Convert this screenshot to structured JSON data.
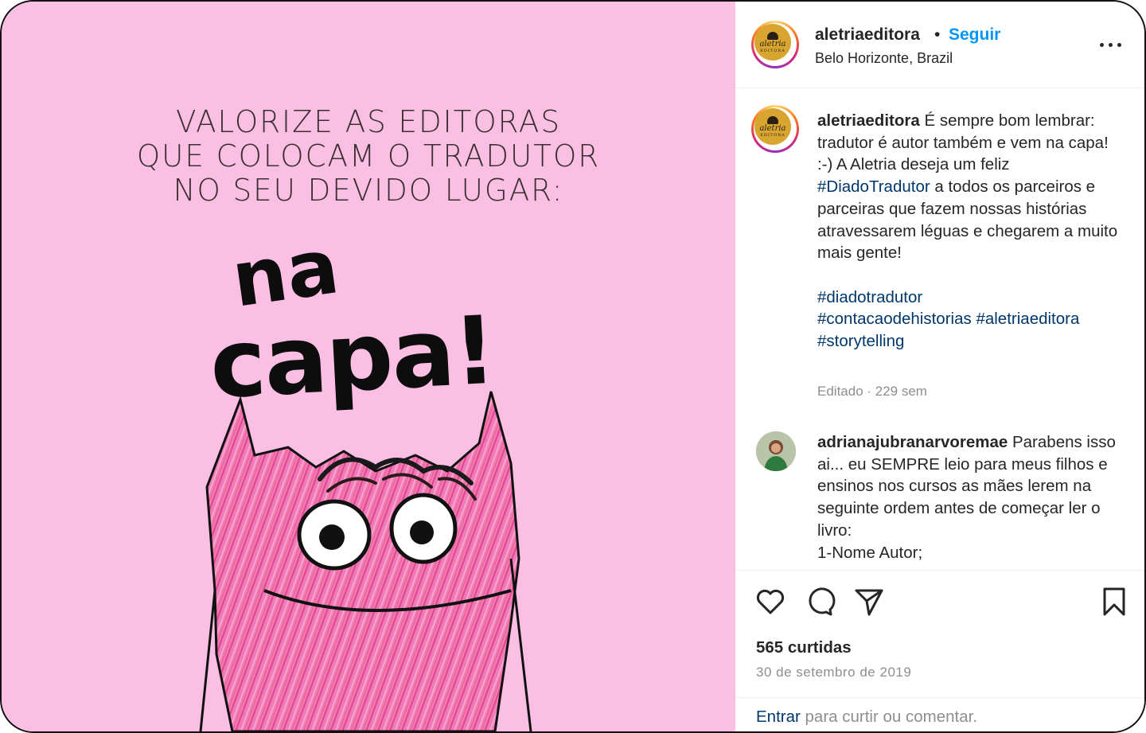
{
  "media": {
    "headline": [
      "VALORIZE AS EDITORAS",
      "QUE COLOCAM O TRADUTOR",
      "NO SEU DEVIDO LUGAR:"
    ],
    "big_text_line1": "na",
    "big_text_line2": "capa!",
    "background_color": "#fcbfe4"
  },
  "header": {
    "username": "aletriaeditora",
    "separator": "•",
    "follow_label": "Seguir",
    "location": "Belo Horizonte, Brazil",
    "avatar_logo_text": "aletria",
    "avatar_logo_sub": "EDITORA",
    "more_icon": "more-horizontal-icon"
  },
  "caption": {
    "username": "aletriaeditora",
    "text_before": "É sempre bom lembrar: tradutor é autor também e vem na capa! :-) A Aletria deseja um feliz ",
    "inline_tag": "#DiadoTradutor",
    "text_after": " a todos os parceiros e parceiras que fazem nossas histórias atravessarem léguas e chegarem a muito mais gente!",
    "hashtags": [
      "#diadotradutor",
      "#contacaodehistorias",
      "#aletriaeditora",
      "#storytelling"
    ],
    "meta": "Editado · 229 sem"
  },
  "comment": {
    "username": "adrianajubranarvoremae",
    "text": "Parabens isso ai... eu SEMPRE leio para meus filhos e ensinos nos cursos as mães lerem na seguinte ordem antes de começar ler o livro:\n1-Nome Autor;"
  },
  "actions": {
    "like_icon": "heart-icon",
    "comment_icon": "comment-icon",
    "share_icon": "paper-plane-icon",
    "save_icon": "bookmark-icon"
  },
  "likes": "565 curtidas",
  "date": "30 de setembro de 2019",
  "login": {
    "link": "Entrar",
    "text": " para curtir ou comentar."
  },
  "colors": {
    "accent": "#0095f6",
    "hashtag": "#00376b",
    "muted": "#8e8e8e"
  }
}
